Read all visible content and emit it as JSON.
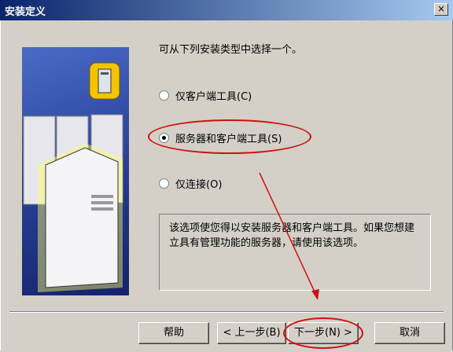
{
  "window": {
    "title": "安装定义",
    "close_glyph": "×"
  },
  "prompt": "可从下列安装类型中选择一个。",
  "options": [
    {
      "label": "仅客户端工具",
      "accel": "(C)",
      "selected": false
    },
    {
      "label": "服务器和客户端工具",
      "accel": "(S)",
      "selected": true
    },
    {
      "label": "仅连接",
      "accel": "(O)",
      "selected": false
    }
  ],
  "description": "该选项使您得以安装服务器和客户端工具。如果您想建立具有管理功能的服务器，请使用该选项。",
  "buttons": {
    "help": "帮助",
    "back": "< 上一步(B)",
    "next": "下一步(N) >",
    "cancel": "取消"
  },
  "colors": {
    "annotation": "#d01010",
    "titlebar": "#0a246a",
    "panel": "#2f4aa8"
  }
}
